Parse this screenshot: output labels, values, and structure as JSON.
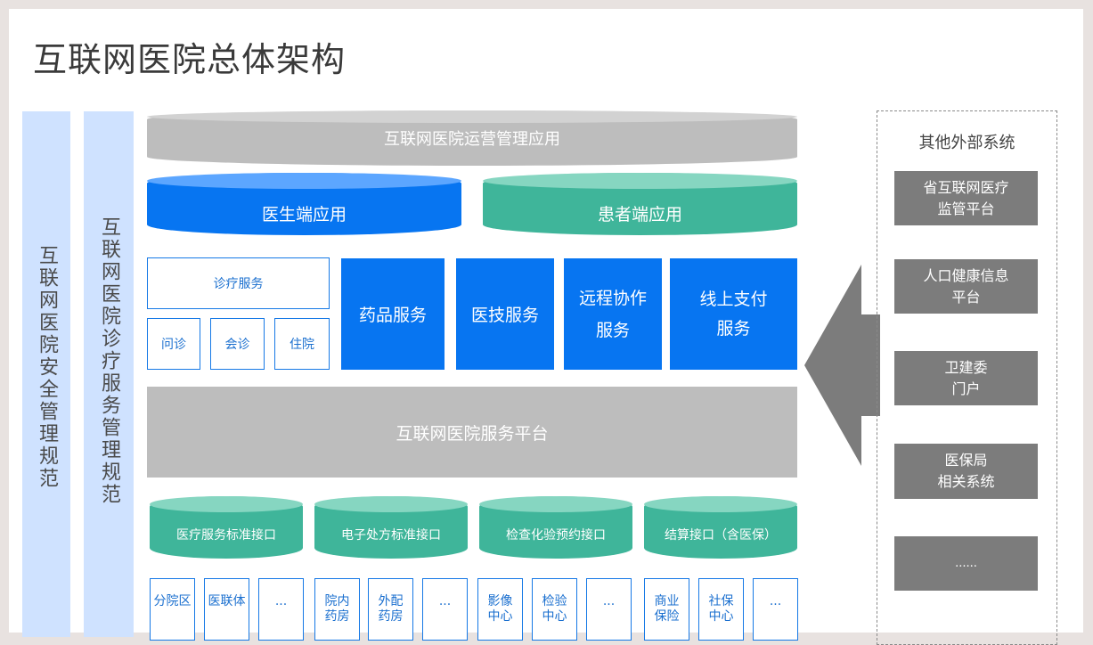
{
  "title": "互联网医院总体架构",
  "left_bars": {
    "security": "互联网医院安全管理规范",
    "service": "互联网医院诊疗服务管理规范"
  },
  "layers": {
    "ops_app": "互联网医院运营管理应用",
    "doctor_app": "医生端应用",
    "patient_app": "患者端应用",
    "consult": {
      "main": "诊疗服务",
      "sub": [
        "问诊",
        "会诊",
        "住院"
      ]
    },
    "services": [
      "药品服务",
      "医技服务",
      "远程协作\n服务",
      "线上支付\n服务"
    ],
    "platform": "互联网医院服务平台",
    "interfaces": [
      "医疗服务标准接口",
      "电子处方标准接口",
      "检查化验预约接口",
      "结算接口（含医保）"
    ],
    "bottom_boxes": [
      "分院区",
      "医联体",
      "...",
      "院内\n药房",
      "外配\n药房",
      "...",
      "影像\n中心",
      "检验\n中心",
      "...",
      "商业\n保险",
      "社保\n中心",
      "..."
    ]
  },
  "external": {
    "heading": "其他外部系统",
    "items": [
      "省互联网医疗\n监管平台",
      "人口健康信息\n平台",
      "卫建委\n门户",
      "医保局\n相关系统",
      "......"
    ]
  },
  "colors": {
    "blue": "#0775f1",
    "teal": "#3fb59a",
    "gray": "#bdbdbd",
    "dark_gray": "#7c7c7c",
    "light_blue_bar": "#cfe2ff"
  }
}
